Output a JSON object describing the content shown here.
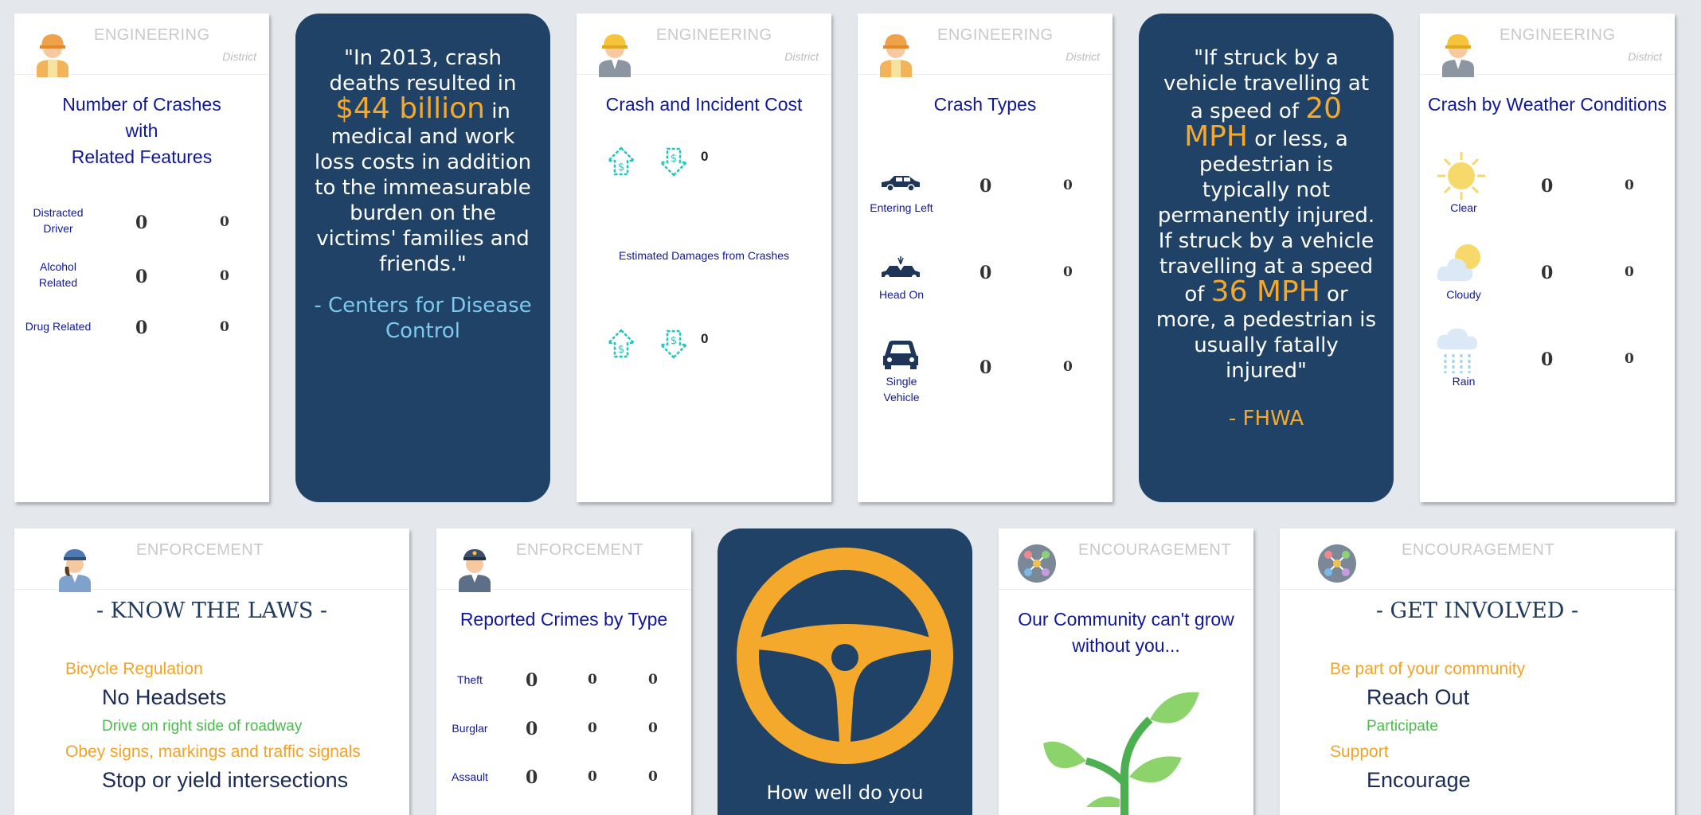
{
  "cards": {
    "crashes_features": {
      "category": "ENGINEERING",
      "district": "District",
      "title_line1": "Number of Crashes",
      "title_line2": "with",
      "title_line3": "Related Features",
      "rows": [
        {
          "label_a": "Distracted",
          "label_b": "Driver",
          "value": "0",
          "value2": "0"
        },
        {
          "label_a": "Alcohol",
          "label_b": "Related",
          "value": "0",
          "value2": "0"
        },
        {
          "label_a": "Drug Related",
          "label_b": "",
          "value": "0",
          "value2": "0"
        }
      ]
    },
    "quote1": {
      "before": "\"In 2013, crash deaths resulted in",
      "highlight": "$44 billion",
      "after": "in medical and work loss costs in addition to the immeasurable burden on the victims' families and friends.\"",
      "source": "- Centers for Disease Control"
    },
    "crash_cost": {
      "category": "ENGINEERING",
      "district": "District",
      "title": "Crash and Incident Cost",
      "value_top": "0",
      "caption": "Estimated Damages from Crashes",
      "value_bottom": "0",
      "colors": {
        "teal": "#21c6bd"
      }
    },
    "crash_types": {
      "category": "ENGINEERING",
      "district": "District",
      "title": "Crash Types",
      "rows": [
        {
          "icon": "car-side-icon",
          "label_a": "Entering Left",
          "label_b": "",
          "value": "0",
          "value2": "0"
        },
        {
          "icon": "head-on-collision-icon",
          "label_a": "Head On",
          "label_b": "",
          "value": "0",
          "value2": "0"
        },
        {
          "icon": "car-front-icon",
          "label_a": "Single",
          "label_b": "Vehicle",
          "value": "0",
          "value2": "0"
        }
      ]
    },
    "quote2": {
      "line1": "\"If struck by a vehicle travelling at a speed of",
      "speed1": "20 MPH",
      "line2": "or less, a pedestrian is typically not permanently injured. If struck by a vehicle travelling at a speed of",
      "speed2": "36 MPH",
      "line3": "or more, a pedestrian is usually fatally injured\"",
      "source": "- FHWA"
    },
    "weather": {
      "category": "ENGINEERING",
      "district": "District",
      "title": "Crash by Weather Conditions",
      "rows": [
        {
          "icon": "sun-icon",
          "label": "Clear",
          "value": "0",
          "value2": "0"
        },
        {
          "icon": "cloud-sun-icon",
          "label": "Cloudy",
          "value": "0",
          "value2": "0"
        },
        {
          "icon": "rain-cloud-icon",
          "label": "Rain",
          "value": "0",
          "value2": "0"
        }
      ]
    },
    "know_laws": {
      "category": "ENFORCEMENT",
      "title": "- KNOW THE LAWS -",
      "items": [
        {
          "style": "orange",
          "text": "Bicycle Regulation"
        },
        {
          "style": "navy",
          "text": "No Headsets"
        },
        {
          "style": "green",
          "text": "Drive on right side of roadway"
        },
        {
          "style": "orange",
          "text": "Obey signs, markings and traffic signals"
        },
        {
          "style": "navy",
          "text": "Stop or yield intersections"
        }
      ]
    },
    "crimes": {
      "category": "ENFORCEMENT",
      "title": "Reported Crimes by Type",
      "rows": [
        {
          "label": "Theft",
          "v1": "0",
          "v2": "0",
          "v3": "0"
        },
        {
          "label": "Burglar",
          "v1": "0",
          "v2": "0",
          "v3": "0"
        },
        {
          "label": "Assault",
          "v1": "0",
          "v2": "0",
          "v3": "0"
        }
      ]
    },
    "steering": {
      "caption": "How well do you",
      "colors": {
        "wheel": "#f5a92c",
        "bg": "#1f4266"
      }
    },
    "community": {
      "category": "ENCOURAGEMENT",
      "title_line1": "Our Community can't grow",
      "title_line2": "without you..."
    },
    "get_involved": {
      "category": "ENCOURAGEMENT",
      "title": "- GET INVOLVED -",
      "items": [
        {
          "style": "orange",
          "text": "Be part of your community"
        },
        {
          "style": "navy",
          "text": "Reach Out"
        },
        {
          "style": "green",
          "text": "Participate"
        },
        {
          "style": "orange",
          "text": "Support"
        },
        {
          "style": "navy",
          "text": "Encourage"
        }
      ]
    }
  }
}
